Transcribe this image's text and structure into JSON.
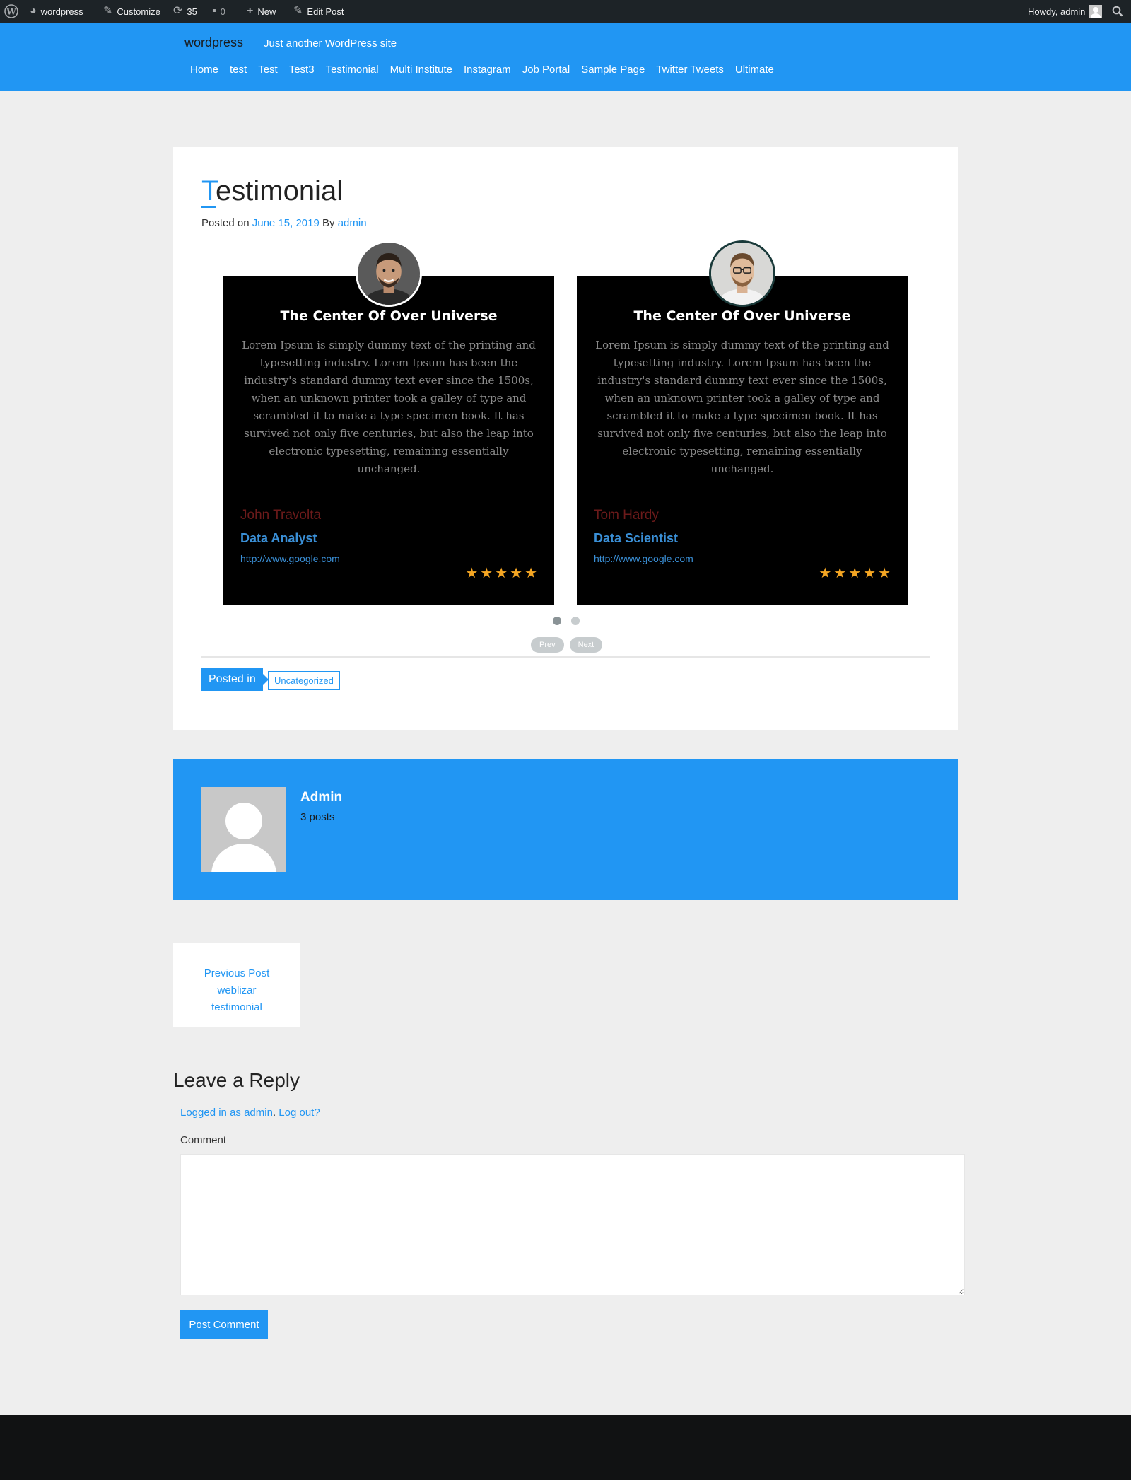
{
  "adminbar": {
    "site_name": "wordpress",
    "customize": "Customize",
    "updates_count": "35",
    "comments_count": "0",
    "new_label": "New",
    "edit_post": "Edit Post",
    "howdy": "Howdy, admin"
  },
  "header": {
    "site_title": "wordpress",
    "tagline": "Just another WordPress site",
    "menu": [
      "Home",
      "test",
      "Test",
      "Test3",
      "Testimonial",
      "Multi Institute",
      "Instagram",
      "Job Portal",
      "Sample Page",
      "Twitter Tweets",
      "Ultimate"
    ]
  },
  "post": {
    "title_first": "T",
    "title_rest": "estimonial",
    "posted_on_label": "Posted on",
    "date": "June 15, 2019",
    "by_label": "By",
    "author": "admin",
    "testimonials": [
      {
        "heading": "The Center Of Over Universe",
        "text": "Lorem Ipsum is simply dummy text of the printing and typesetting industry. Lorem Ipsum has been the industry's standard dummy text ever since the 1500s, when an unknown printer took a galley of type and scrambled it to make a type specimen book. It has survived not only five centuries, but also the leap into electronic typesetting, remaining essentially unchanged.",
        "name": "John Travolta",
        "role": "Data Analyst",
        "url": "http://www.google.com",
        "rating": 5
      },
      {
        "heading": "The Center Of Over Universe",
        "text": "Lorem Ipsum is simply dummy text of the printing and typesetting industry. Lorem Ipsum has been the industry's standard dummy text ever since the 1500s, when an unknown printer took a galley of type and scrambled it to make a type specimen book. It has survived not only five centuries, but also the leap into electronic typesetting, remaining essentially unchanged.",
        "name": "Tom Hardy",
        "role": "Data Scientist",
        "url": "http://www.google.com",
        "rating": 5
      }
    ],
    "prev_label": "Prev",
    "next_label": "Next",
    "posted_in_label": "Posted in",
    "category": "Uncategorized"
  },
  "author_box": {
    "name": "Admin",
    "posts": "3 posts"
  },
  "post_nav": {
    "label": "Previous Post",
    "line1": "weblizar",
    "line2": "testimonial"
  },
  "reply": {
    "title": "Leave a Reply",
    "logged_in_as": "Logged in as admin",
    "logout": "Log out?",
    "comment_label": "Comment",
    "submit": "Post Comment"
  },
  "colors": {
    "accent": "#2196f3",
    "adminbar": "#1d2327",
    "star": "#f5a623"
  }
}
